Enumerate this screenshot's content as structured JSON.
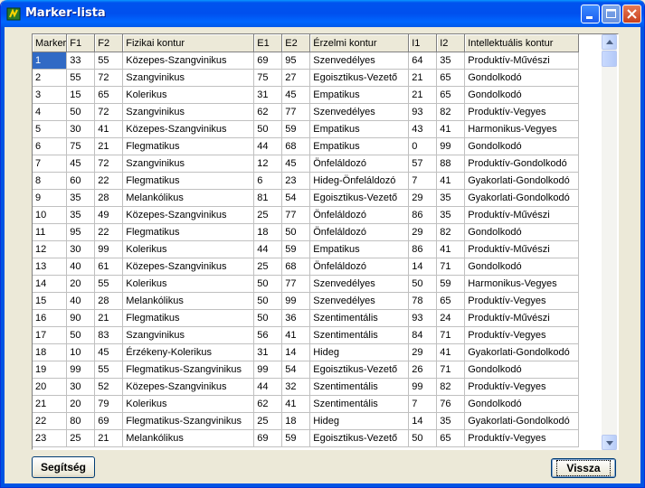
{
  "window": {
    "title": "Marker-lista"
  },
  "grid": {
    "columns": [
      "Marker",
      "F1",
      "F2",
      "Fizikai kontur",
      "E1",
      "E2",
      "Érzelmi kontur",
      "I1",
      "I2",
      "Intellektuális kontur"
    ],
    "rows": [
      [
        "1",
        "33",
        "55",
        "Közepes-Szangvinikus",
        "69",
        "95",
        "Szenvedélyes",
        "64",
        "35",
        "Produktív-Művészi"
      ],
      [
        "2",
        "55",
        "72",
        "Szangvinikus",
        "75",
        "27",
        "Egoisztikus-Vezető",
        "21",
        "65",
        "Gondolkodó"
      ],
      [
        "3",
        "15",
        "65",
        "Kolerikus",
        "31",
        "45",
        "Empatikus",
        "21",
        "65",
        "Gondolkodó"
      ],
      [
        "4",
        "50",
        "72",
        "Szangvinikus",
        "62",
        "77",
        "Szenvedélyes",
        "93",
        "82",
        "Produktív-Vegyes"
      ],
      [
        "5",
        "30",
        "41",
        "Közepes-Szangvinikus",
        "50",
        "59",
        "Empatikus",
        "43",
        "41",
        "Harmonikus-Vegyes"
      ],
      [
        "6",
        "75",
        "21",
        "Flegmatikus",
        "44",
        "68",
        "Empatikus",
        "0",
        "99",
        "Gondolkodó"
      ],
      [
        "7",
        "45",
        "72",
        "Szangvinikus",
        "12",
        "45",
        "Önfeláldozó",
        "57",
        "88",
        "Produktív-Gondolkodó"
      ],
      [
        "8",
        "60",
        "22",
        "Flegmatikus",
        "6",
        "23",
        "Hideg-Önfeláldozó",
        "7",
        "41",
        "Gyakorlati-Gondolkodó"
      ],
      [
        "9",
        "35",
        "28",
        "Melankólikus",
        "81",
        "54",
        "Egoisztikus-Vezető",
        "29",
        "35",
        "Gyakorlati-Gondolkodó"
      ],
      [
        "10",
        "35",
        "49",
        "Közepes-Szangvinikus",
        "25",
        "77",
        "Önfeláldozó",
        "86",
        "35",
        "Produktív-Művészi"
      ],
      [
        "11",
        "95",
        "22",
        "Flegmatikus",
        "18",
        "50",
        "Önfeláldozó",
        "29",
        "82",
        "Gondolkodó"
      ],
      [
        "12",
        "30",
        "99",
        "Kolerikus",
        "44",
        "59",
        "Empatikus",
        "86",
        "41",
        "Produktív-Művészi"
      ],
      [
        "13",
        "40",
        "61",
        "Közepes-Szangvinikus",
        "25",
        "68",
        "Önfeláldozó",
        "14",
        "71",
        "Gondolkodó"
      ],
      [
        "14",
        "20",
        "55",
        "Kolerikus",
        "50",
        "77",
        "Szenvedélyes",
        "50",
        "59",
        "Harmonikus-Vegyes"
      ],
      [
        "15",
        "40",
        "28",
        "Melankólikus",
        "50",
        "99",
        "Szenvedélyes",
        "78",
        "65",
        "Produktív-Vegyes"
      ],
      [
        "16",
        "90",
        "21",
        "Flegmatikus",
        "50",
        "36",
        "Szentimentális",
        "93",
        "24",
        "Produktív-Művészi"
      ],
      [
        "17",
        "50",
        "83",
        "Szangvinikus",
        "56",
        "41",
        "Szentimentális",
        "84",
        "71",
        "Produktív-Vegyes"
      ],
      [
        "18",
        "10",
        "45",
        "Érzékeny-Kolerikus",
        "31",
        "14",
        "Hideg",
        "29",
        "41",
        "Gyakorlati-Gondolkodó"
      ],
      [
        "19",
        "99",
        "55",
        "Flegmatikus-Szangvinikus",
        "99",
        "54",
        "Egoisztikus-Vezető",
        "26",
        "71",
        "Gondolkodó"
      ],
      [
        "20",
        "30",
        "52",
        "Közepes-Szangvinikus",
        "44",
        "32",
        "Szentimentális",
        "99",
        "82",
        "Produktív-Vegyes"
      ],
      [
        "21",
        "20",
        "79",
        "Kolerikus",
        "62",
        "41",
        "Szentimentális",
        "7",
        "76",
        "Gondolkodó"
      ],
      [
        "22",
        "80",
        "69",
        "Flegmatikus-Szangvinikus",
        "25",
        "18",
        "Hideg",
        "14",
        "35",
        "Gyakorlati-Gondolkodó"
      ],
      [
        "23",
        "25",
        "21",
        "Melankólikus",
        "69",
        "59",
        "Egoisztikus-Vezető",
        "50",
        "65",
        "Produktív-Vegyes"
      ]
    ]
  },
  "buttons": {
    "help": "Segítség",
    "back": "Vissza"
  },
  "colors": {
    "selection": "#316ac5",
    "titlebar": "#0054e3"
  }
}
